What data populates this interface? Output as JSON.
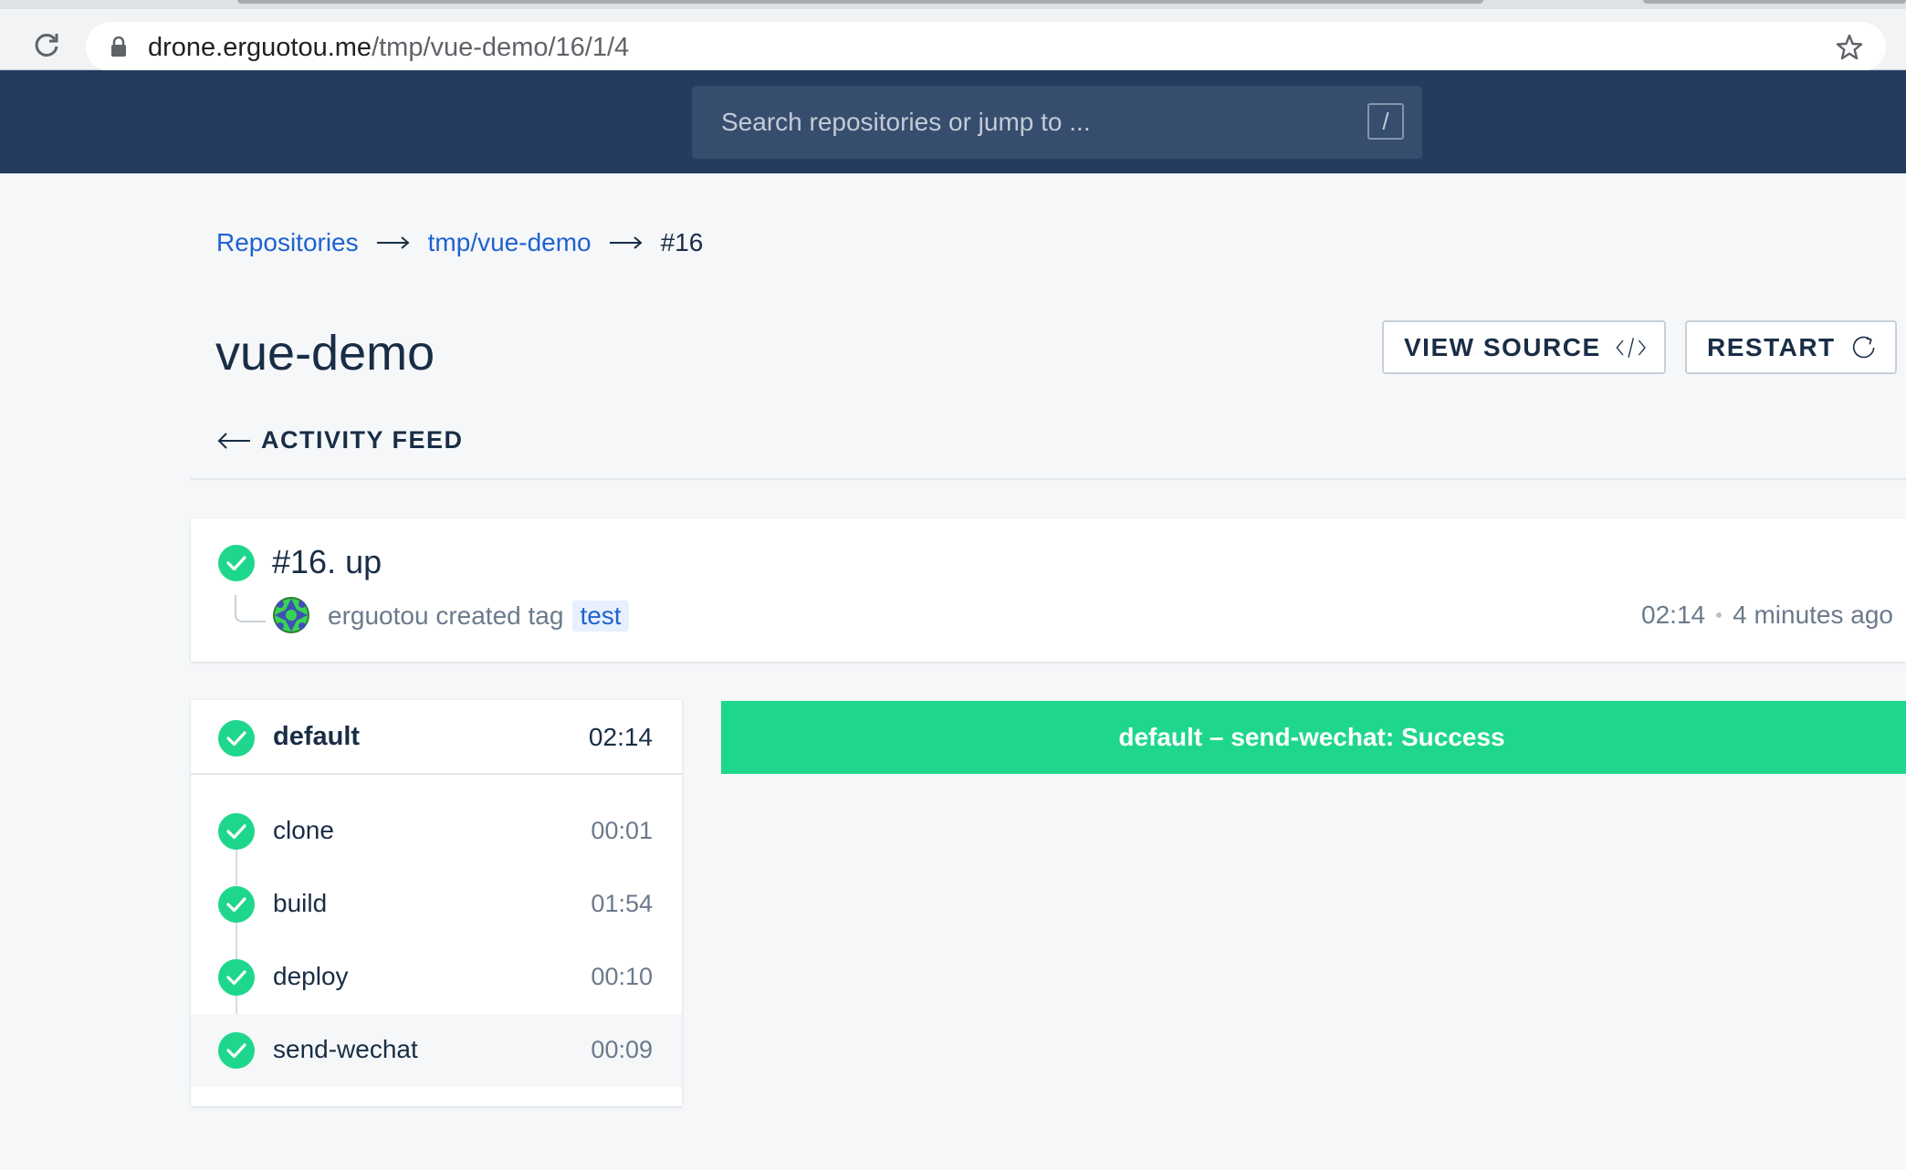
{
  "browser": {
    "url_host": "drone.erguotou.me",
    "url_path": "/tmp/vue-demo/16/1/4"
  },
  "header": {
    "search_placeholder": "Search repositories or jump to ...",
    "search_shortcut": "/"
  },
  "breadcrumb": {
    "items": [
      "Repositories",
      "tmp/vue-demo"
    ],
    "current": "#16"
  },
  "page": {
    "title": "vue-demo",
    "view_source_label": "VIEW SOURCE",
    "restart_label": "RESTART",
    "activity_feed_label": "ACTIVITY FEED"
  },
  "build": {
    "title": "#16. up",
    "author": "erguotou",
    "action": "created tag",
    "tag": "test",
    "duration": "02:14",
    "relative_time": "4 minutes ago",
    "status": "success"
  },
  "stage": {
    "name": "default",
    "duration": "02:14",
    "steps": [
      {
        "name": "clone",
        "duration": "00:01"
      },
      {
        "name": "build",
        "duration": "01:54"
      },
      {
        "name": "deploy",
        "duration": "00:10"
      },
      {
        "name": "send-wechat",
        "duration": "00:09"
      }
    ]
  },
  "banner": {
    "text": "default – send-wechat: Success"
  },
  "colors": {
    "navbar": "#253c5f",
    "success": "#1fd78c",
    "link": "#1e62d0"
  }
}
